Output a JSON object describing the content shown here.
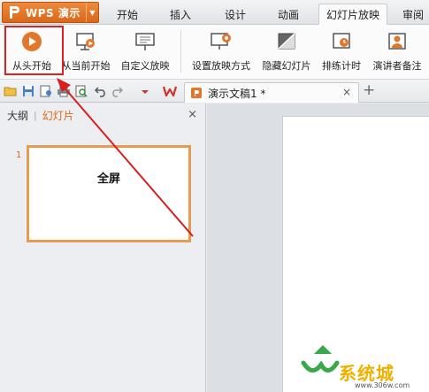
{
  "app": {
    "name": "WPS 演示"
  },
  "tabs": [
    {
      "label": "开始"
    },
    {
      "label": "插入"
    },
    {
      "label": "设计"
    },
    {
      "label": "动画"
    },
    {
      "label": "幻灯片放映"
    },
    {
      "label": "审阅"
    }
  ],
  "ribbon": {
    "from_start": "从头开始",
    "from_current": "从当前开始",
    "custom_show": "自定义放映",
    "setup_show": "设置放映方式",
    "hide_slide": "隐藏幻灯片",
    "rehearse": "排练计时",
    "presenter_notes": "演讲者备注"
  },
  "doc_tab": {
    "title": "演示文稿1 *",
    "close": "×"
  },
  "new_tab": "+",
  "left_panel": {
    "outline_tab": "大纲",
    "separator": "|",
    "slides_tab": "幻灯片",
    "close": "×"
  },
  "slide_thumb": {
    "number": "1",
    "text": "全屏"
  },
  "watermark": {
    "brand": "系统城",
    "url": "www.306w.com"
  },
  "colors": {
    "app_orange": "#d9681a",
    "accent": "#d86a16",
    "highlight_red": "#e02020"
  }
}
